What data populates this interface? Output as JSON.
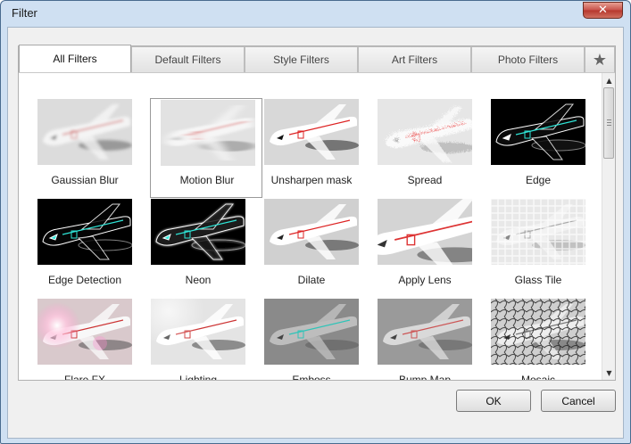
{
  "window": {
    "title": "Filter",
    "close_glyph": "✕"
  },
  "tabs": [
    {
      "label": "All Filters",
      "active": true
    },
    {
      "label": "Default Filters",
      "active": false
    },
    {
      "label": "Style Filters",
      "active": false
    },
    {
      "label": "Art Filters",
      "active": false
    },
    {
      "label": "Photo Filters",
      "active": false
    }
  ],
  "favorites_tab": {
    "glyph": "★",
    "icon": "star-icon"
  },
  "filters": [
    {
      "label": "Gaussian Blur",
      "style": "blur"
    },
    {
      "label": "Motion Blur",
      "style": "motion",
      "selected": true
    },
    {
      "label": "Unsharpen mask",
      "style": "sharp"
    },
    {
      "label": "Spread",
      "style": "spread"
    },
    {
      "label": "Edge",
      "style": "edge"
    },
    {
      "label": "Edge Detection",
      "style": "edgedet"
    },
    {
      "label": "Neon",
      "style": "neon"
    },
    {
      "label": "Dilate",
      "style": "dilate"
    },
    {
      "label": "Apply Lens",
      "style": "lens"
    },
    {
      "label": "Glass Tile",
      "style": "glass"
    },
    {
      "label": "Flare FX",
      "style": "flare"
    },
    {
      "label": "Lighting",
      "style": "light"
    },
    {
      "label": "Emboss",
      "style": "emboss"
    },
    {
      "label": "Bump Map",
      "style": "bump"
    },
    {
      "label": "Mosaic",
      "style": "mosaic"
    }
  ],
  "scrollbar": {
    "up_glyph": "▲",
    "down_glyph": "▼"
  },
  "buttons": {
    "ok": "OK",
    "cancel": "Cancel"
  }
}
